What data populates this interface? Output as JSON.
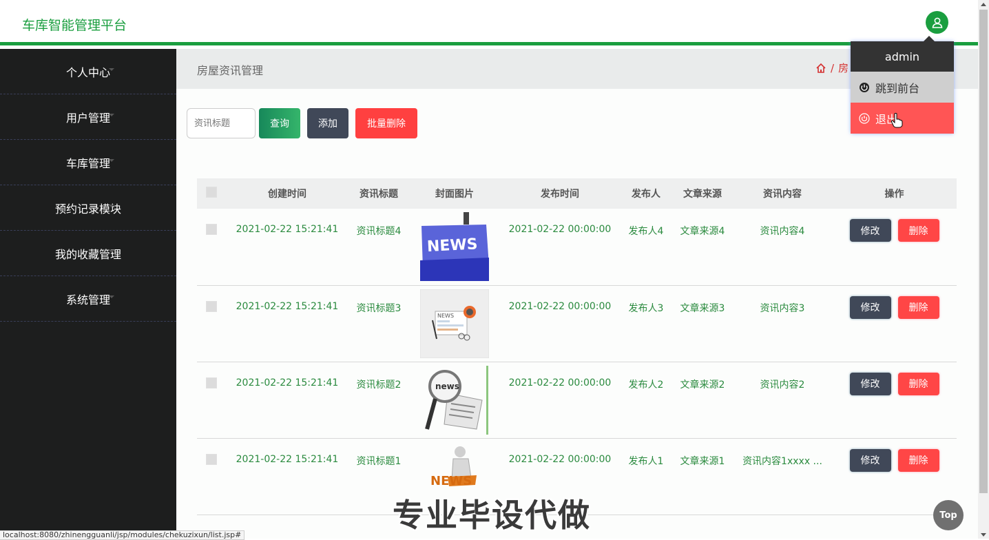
{
  "header": {
    "brand": "车库智能管理平台",
    "avatar_icon": "user-icon"
  },
  "sidebar": {
    "items": [
      {
        "label": "个人中心"
      },
      {
        "label": "用户管理"
      },
      {
        "label": "车库管理"
      },
      {
        "label": "预约记录模块"
      },
      {
        "label": "我的收藏管理"
      },
      {
        "label": "系统管理"
      }
    ]
  },
  "page": {
    "title": "房屋资讯管理",
    "breadcrumb_sep": "/",
    "breadcrumb_partial": "房"
  },
  "toolbar": {
    "search_placeholder": "资讯标题",
    "query_label": "查询",
    "add_label": "添加",
    "batch_delete_label": "批量删除"
  },
  "table": {
    "headers": [
      "创建时间",
      "资讯标题",
      "封面图片",
      "发布时间",
      "发布人",
      "文章来源",
      "资讯内容",
      "操作"
    ],
    "rows": [
      {
        "created": "2021-02-22 15:21:41",
        "title": "资讯标题4",
        "published": "2021-02-22 00:00:00",
        "publisher": "发布人4",
        "source": "文章来源4",
        "content": "资讯内容4",
        "image": "news-keyboard-image"
      },
      {
        "created": "2021-02-22 15:21:41",
        "title": "资讯标题3",
        "published": "2021-02-22 00:00:00",
        "publisher": "发布人3",
        "source": "文章来源3",
        "content": "资讯内容3",
        "image": "news-paper-image"
      },
      {
        "created": "2021-02-22 15:21:41",
        "title": "资讯标题2",
        "published": "2021-02-22 00:00:00",
        "publisher": "发布人2",
        "source": "文章来源2",
        "content": "资讯内容2",
        "image": "news-magnifier-image"
      },
      {
        "created": "2021-02-22 15:21:41",
        "title": "资讯标题1",
        "published": "2021-02-22 00:00:00",
        "publisher": "发布人1",
        "source": "文章来源1",
        "content": "资讯内容1xxxx ...",
        "image": "news-figure-image"
      }
    ],
    "edit_label": "修改",
    "delete_label": "删除"
  },
  "user_menu": {
    "username": "admin",
    "front_label": "跳到前台",
    "logout_label": "退出"
  },
  "back_to_top": "Top",
  "status_url": "localhost:8080/zhinengguanli/jsp/modules/chekuzixun/list.jsp#",
  "watermark": "专业毕设代做",
  "colors": {
    "brand_green": "#1a9e3f",
    "sidebar_bg": "#1d1e1e",
    "danger": "#ff4646",
    "dark_btn": "#404858"
  }
}
